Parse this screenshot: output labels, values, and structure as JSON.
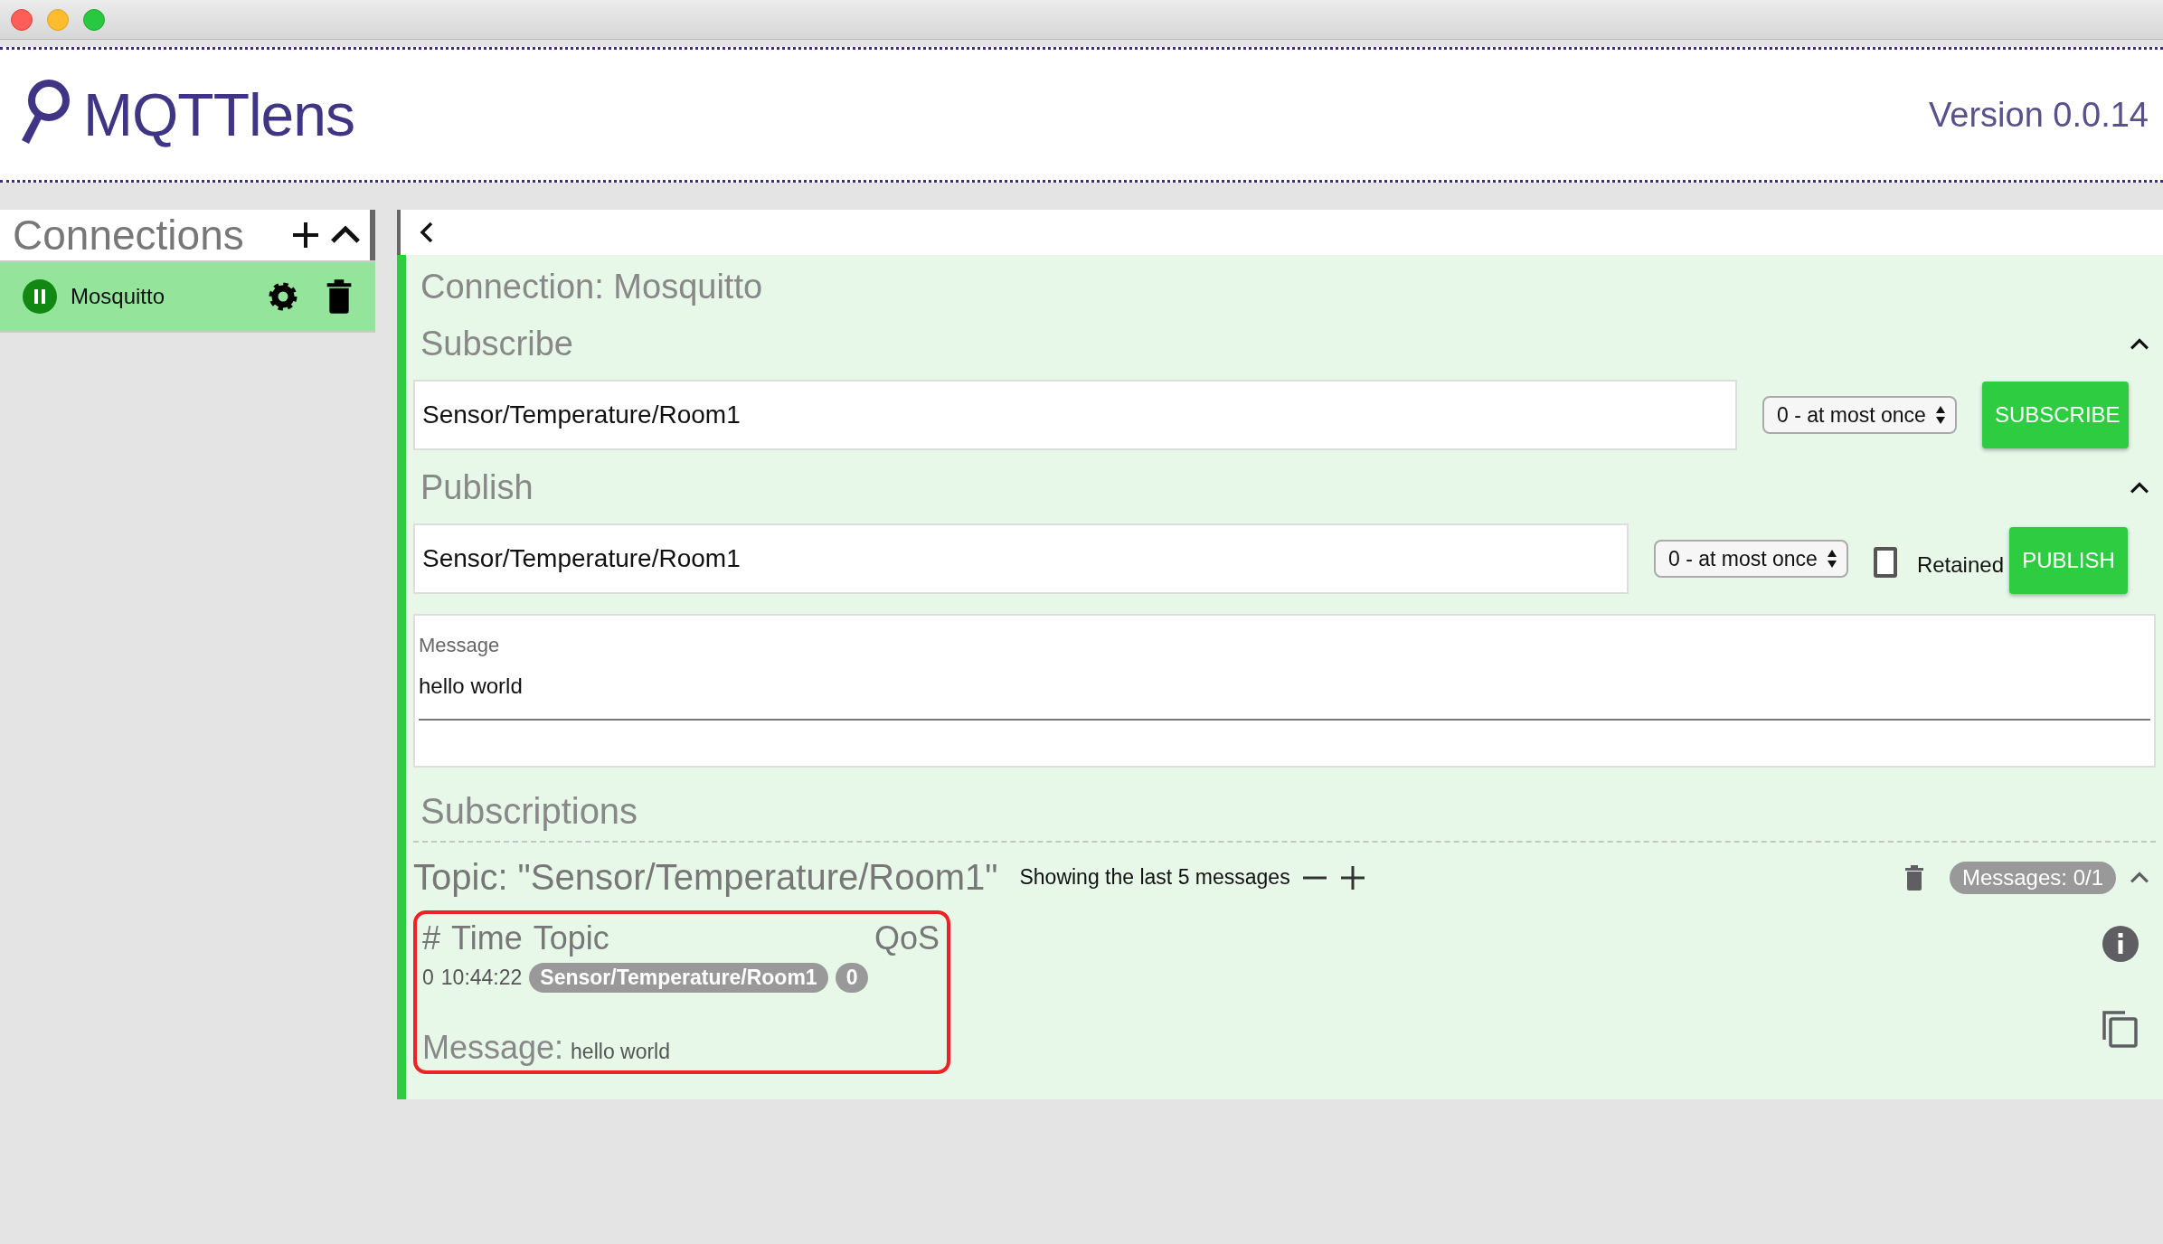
{
  "app": {
    "name": "MQTTlens",
    "version": "Version 0.0.14"
  },
  "connections": {
    "title": "Connections",
    "items": [
      {
        "name": "Mosquitto",
        "selected": true,
        "connected": true
      }
    ]
  },
  "connection": {
    "title": "Connection: Mosquitto",
    "subscribe": {
      "heading": "Subscribe",
      "expanded": true,
      "topic": "Sensor/Temperature/Room1",
      "qos": "0 - at most once",
      "button": "SUBSCRIBE"
    },
    "publish": {
      "heading": "Publish",
      "expanded": true,
      "topic": "Sensor/Temperature/Room1",
      "qos": "0 - at most once",
      "retained": false,
      "retained_label": "Retained",
      "button": "PUBLISH",
      "message_label": "Message",
      "message": "hello world"
    },
    "subscriptions": {
      "heading": "Subscriptions",
      "items": [
        {
          "topic": "Topic: \"Sensor/Temperature/Room1\"",
          "showing": "Showing the last 5 messages",
          "messages_badge": "Messages: 0/1",
          "expanded": true,
          "columns": [
            "#",
            "Time",
            "Topic",
            "QoS"
          ],
          "messages": [
            {
              "index": "0",
              "time": "10:44:22",
              "topic": "Sensor/Temperature/Room1",
              "qos": "0",
              "message_label": "Message:",
              "message": "hello world",
              "highlighted": true
            }
          ]
        }
      ]
    }
  }
}
